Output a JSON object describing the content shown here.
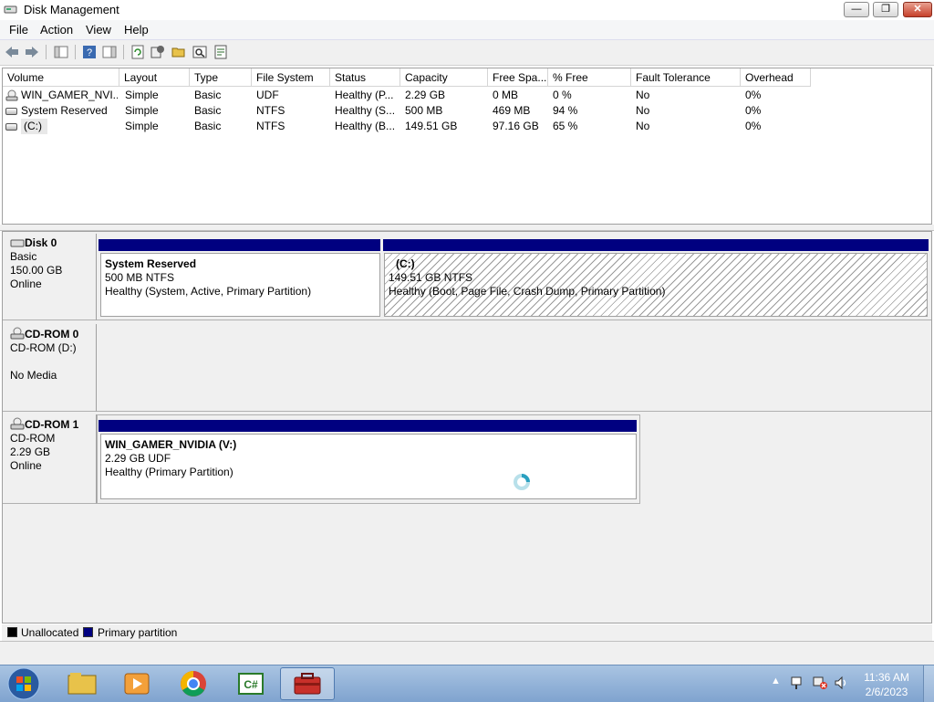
{
  "window": {
    "title": "Disk Management",
    "close_label": "✕",
    "minimize_label": "—",
    "maximize_label": "❐"
  },
  "menu": [
    "File",
    "Action",
    "View",
    "Help"
  ],
  "columns": [
    "Volume",
    "Layout",
    "Type",
    "File System",
    "Status",
    "Capacity",
    "Free Spa...",
    "% Free",
    "Fault Tolerance",
    "Overhead"
  ],
  "volumes": [
    [
      "WIN_GAMER_NVI...",
      "Simple",
      "Basic",
      "UDF",
      "Healthy (P...",
      "2.29 GB",
      "0 MB",
      "0 %",
      "No",
      "0%"
    ],
    [
      "System Reserved",
      "Simple",
      "Basic",
      "NTFS",
      "Healthy (S...",
      "500 MB",
      "469 MB",
      "94 %",
      "No",
      "0%"
    ],
    [
      "(C:)",
      "Simple",
      "Basic",
      "NTFS",
      "Healthy (B...",
      "149.51 GB",
      "97.16 GB",
      "65 %",
      "No",
      "0%"
    ]
  ],
  "disks": {
    "disk0": {
      "name": "Disk 0",
      "type": "Basic",
      "size": "150.00 GB",
      "state": "Online"
    },
    "cdrom0": {
      "name": "CD-ROM 0",
      "type": "CD-ROM (D:)",
      "state": "No Media"
    },
    "cdrom1": {
      "name": "CD-ROM 1",
      "type": "CD-ROM",
      "size": "2.29 GB",
      "state": "Online"
    }
  },
  "partitions": {
    "sysres": {
      "name": "System Reserved",
      "size": "500 MB NTFS",
      "status": "Healthy (System, Active, Primary Partition)"
    },
    "c": {
      "name": "(C:)",
      "size": "149.51 GB NTFS",
      "status": "Healthy (Boot, Page File, Crash Dump, Primary Partition)"
    },
    "v": {
      "name": "WIN_GAMER_NVIDIA  (V:)",
      "size": "2.29 GB UDF",
      "status": "Healthy (Primary Partition)"
    }
  },
  "legend": {
    "unallocated": "Unallocated",
    "primary": "Primary partition"
  },
  "colors": {
    "primary": "#000080",
    "unallocated": "#000000"
  },
  "taskbar": {
    "apps": [
      "start-orb",
      "explorer-icon",
      "media-player-icon",
      "chrome-icon",
      "csharp-icon",
      "computer-management-icon"
    ],
    "time": "11:36 AM",
    "date": "2/6/2023"
  }
}
